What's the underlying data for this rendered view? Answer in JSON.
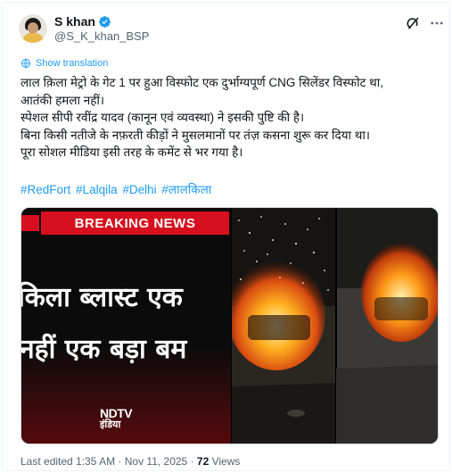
{
  "author": {
    "name": "S khan",
    "handle": "@S_K_khan_BSP",
    "verified": true,
    "badge_color": "#1d9bf0"
  },
  "header_icons": [
    "grok-icon",
    "more-icon"
  ],
  "translation": {
    "label": "Show translation",
    "icon": "globe-icon"
  },
  "tweet": {
    "lines": [
      "लाल क़िला मेट्रो के गेट 1 पर हुआ विस्फोट एक दुर्भाग्यपूर्ण CNG सिलेंडर विस्फोट था,",
      "आतंकी हमला नहीं।",
      "स्पेशल सीपी रवींद्र यादव (कानून एवं व्यवस्था) ने इसकी पुष्टि की है।",
      "बिना किसी नतीजे के नफ़रती कीड़ों ने मुसलमानों पर तंज़ कसना शुरू कर दिया था।",
      "पूरा सोशल मीडिया इसी तरह के कमेंट से भर गया है।"
    ],
    "hashtags": [
      "#RedFort",
      "#Lalqila",
      "#Delhi",
      "#लालकिला"
    ]
  },
  "media": {
    "banner": "BREAKING NEWS",
    "headline_line1": "किला ब्लास्ट एक",
    "headline_line2": "नहीं एक बड़ा बम",
    "channel_logo": "NDTV",
    "channel_sub": "इंडिया",
    "banner_color": "#d7101f"
  },
  "footer": {
    "edited": "Last edited 1:35 AM · Nov 11, 2025 · ",
    "views_count": "72",
    "views_label": " Views"
  },
  "colors": {
    "link": "#1d9bf0",
    "text": "#0f1419",
    "muted": "#536471"
  }
}
